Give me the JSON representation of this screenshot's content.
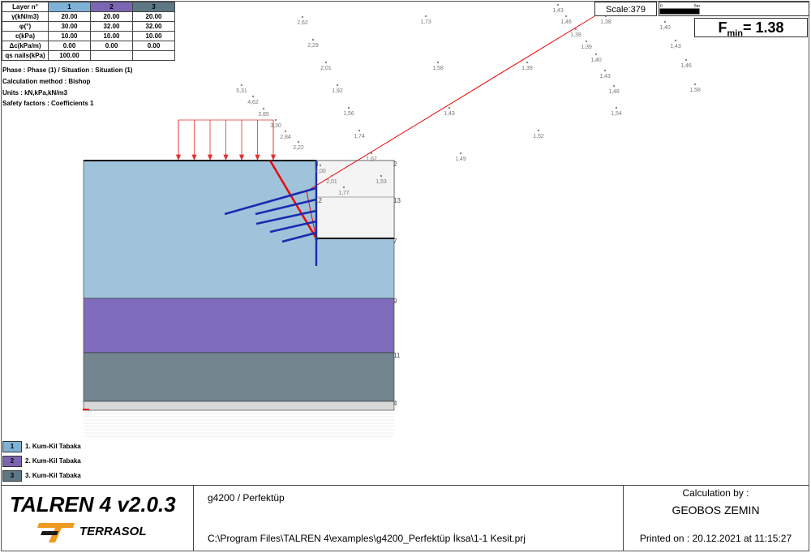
{
  "params": {
    "header": [
      "Layer n°",
      "1",
      "2",
      "3"
    ],
    "rows": [
      {
        "label": "γ(kN/m3)",
        "v": [
          "20.00",
          "20.00",
          "20.00"
        ]
      },
      {
        "label": "φ(°)",
        "v": [
          "30.00",
          "32.00",
          "32.00"
        ]
      },
      {
        "label": "c(kPa)",
        "v": [
          "10.00",
          "10.00",
          "10.00"
        ]
      },
      {
        "label": "Δc(kPa/m)",
        "v": [
          "0.00",
          "0.00",
          "0.00"
        ]
      },
      {
        "label": "qs nails(kPa)",
        "v": [
          "100.00",
          "",
          ""
        ]
      }
    ]
  },
  "info": {
    "phase": "Phase : Phase (1)  / Situation : Situation (1)",
    "method": "Calculation method :  Bishop",
    "units": "Units : kN,kPa,kN/m3",
    "safety": "Safety factors : Coefficients  1"
  },
  "scale": {
    "label": "Scale:379",
    "bar_start": "0",
    "bar_end": "5m"
  },
  "fmin": {
    "label": "F",
    "sub": "min",
    "value": "= 1.38"
  },
  "factors": [
    "1,43",
    "1,46",
    "1,38",
    "1,40",
    "1,39",
    "1,39",
    "1,43",
    "1,40",
    "1,46",
    "1,43",
    "1,48",
    "1,58",
    "1,54",
    "2,62",
    "1,73",
    "2,29",
    "2,01",
    "1,58",
    "1,39",
    "5,31",
    "1,92",
    "4,62",
    "3,85",
    "1,56",
    "1,43",
    "3,30",
    "2,84",
    "1,74",
    "1,52",
    "2,22",
    "1,62",
    "1,49",
    "2,00",
    "2,01",
    "1,53",
    "1,77"
  ],
  "nodes": [
    "3",
    "2",
    "12",
    "13",
    "6",
    "7",
    "9",
    "11",
    "4"
  ],
  "legend": [
    {
      "num": "1",
      "name": "1. Kum-Kil Tabaka",
      "color": "#7fb2d6"
    },
    {
      "num": "2",
      "name": "2. Kum-Kil Tabaka",
      "color": "#7c66b4"
    },
    {
      "num": "3",
      "name": "3. Kum-Kil Tabaka",
      "color": "#5d7784"
    }
  ],
  "footer": {
    "app": "TALREN 4 v2.0.3",
    "brand": "TERRASOL",
    "project": "g4200 / Perfektüp",
    "path": "C:\\Program Files\\TALREN 4\\examples\\g4200_Perfektüp İksa\\1-1 Kesit.prj",
    "calc_label": "Calculation by :",
    "calc_by": "GEOBOS ZEMIN",
    "printed": "Printed on : 20.12.2021 at 11:15:27"
  }
}
